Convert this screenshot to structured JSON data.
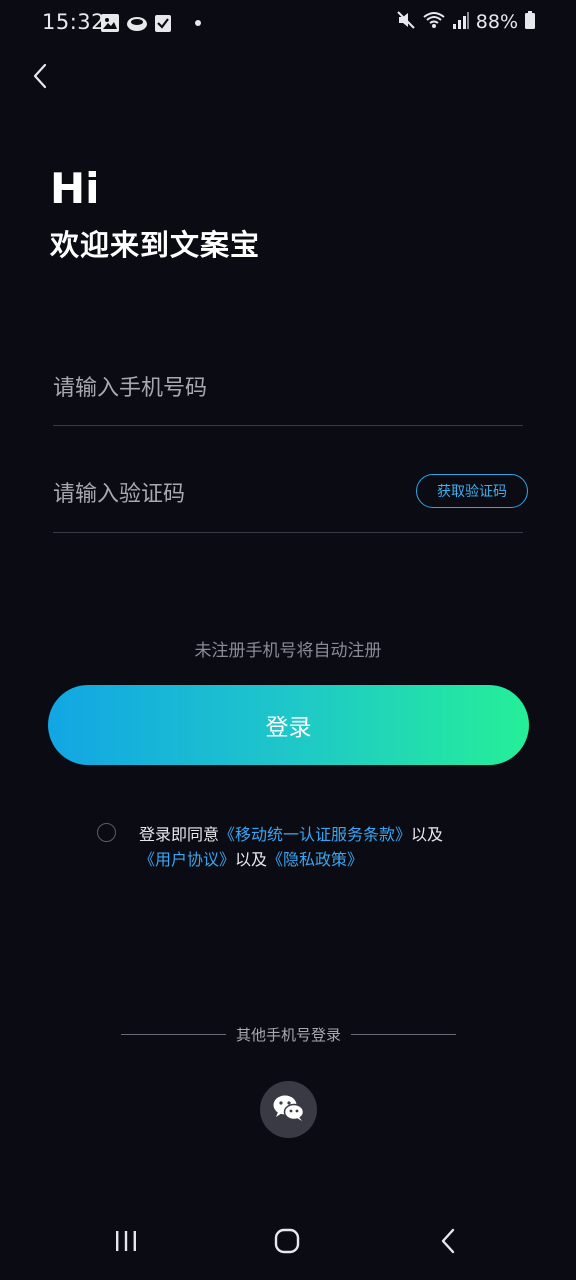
{
  "status_bar": {
    "time": "15:32",
    "battery_percent": "88%",
    "left_icons": [
      "image-icon",
      "cloud-icon",
      "checkbox-icon",
      "dot-icon"
    ],
    "right_icons": [
      "mute-icon",
      "wifi-icon",
      "signal-icon",
      "battery-icon"
    ]
  },
  "header": {
    "back_icon": "chevron-left-icon"
  },
  "hero": {
    "greeting": "Hi",
    "welcome": "欢迎来到文案宝"
  },
  "form": {
    "phone_placeholder": "请输入手机号码",
    "code_placeholder": "请输入验证码",
    "get_code_label": "获取验证码",
    "hint": "未注册手机号将自动注册",
    "login_label": "登录"
  },
  "agreement": {
    "prefix": "登录即同意",
    "link1": "《移动统一认证服务条款》",
    "and1": "以及",
    "link2": "《用户协议》",
    "and2": "以及",
    "link3": "《隐私政策》",
    "checked": false
  },
  "other_login": {
    "label": "其他手机号登录",
    "wechat_icon": "wechat-icon"
  },
  "nav": {
    "icons": [
      "recent-apps-icon",
      "home-icon",
      "back-icon"
    ]
  },
  "colors": {
    "background": "#0b0b14",
    "accent_blue": "#3aa5f0",
    "gradient_start": "#12a6e4",
    "gradient_end": "#25ef98"
  }
}
